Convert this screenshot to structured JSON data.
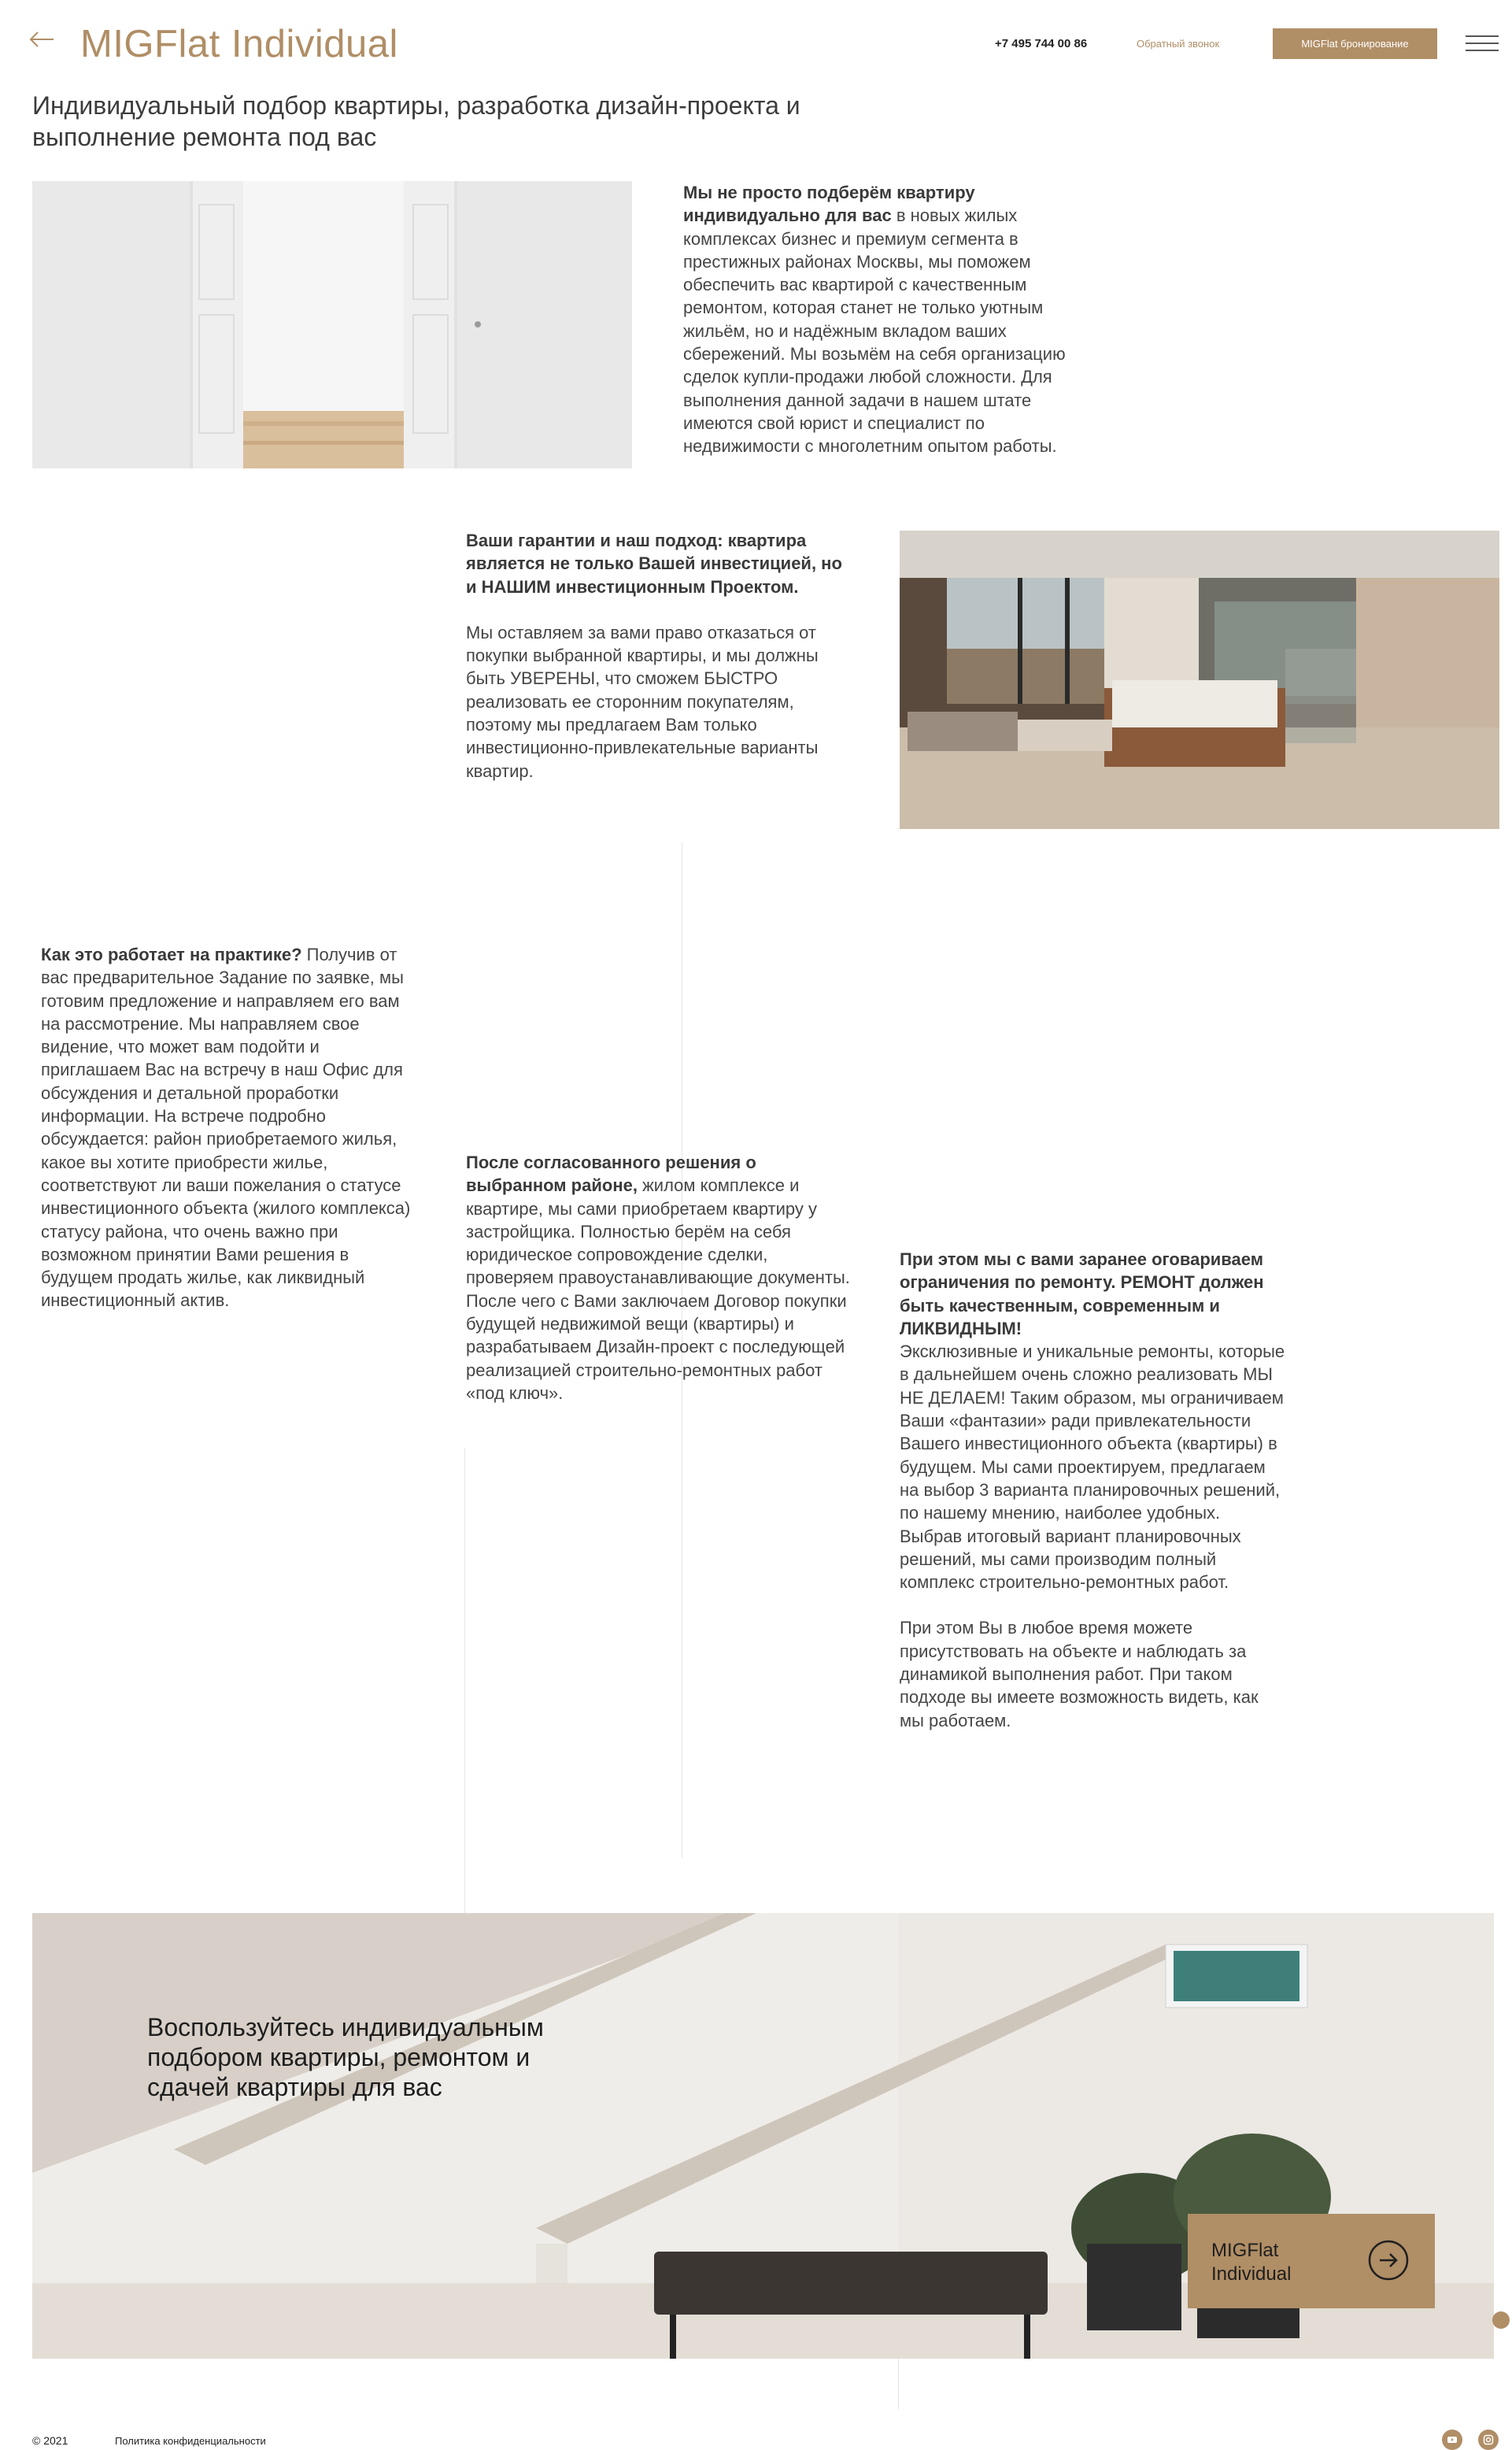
{
  "header": {
    "title": "MIGFlat Individual",
    "phone": "+7 495 744 00 86",
    "callback_label": "Обратный звонок",
    "booking_label": "MIGFlat бронирование"
  },
  "subtitle": "Индивидуальный подбор квартиры, разработка дизайн-проекта и выполнение ремонта под вас",
  "blocks": {
    "b1_bold": "Мы не просто подберём квартиру индивидуально для вас",
    "b1_text": " в новых жилых комплексах бизнес и премиум сегмента в престижных районах Москвы, мы поможем обеспечить вас квартирой с качественным ремонтом, которая станет не только уютным жильём, но и надёжным вкладом ваших сбережений. Мы возьмём на себя организацию сделок купли-продажи любой сложности. Для выполнения данной задачи в нашем штате имеются свой юрист и специалист по недвижимости с многолетним опытом работы.",
    "b2_bold": "Ваши гарантии и наш подход: квартира является не только Вашей инвестицией, но и НАШИМ инвестиционным Проектом.",
    "b2_text": "Мы оставляем за вами право отказаться от покупки выбранной квартиры, и мы должны быть УВЕРЕНЫ, что сможем БЫСТРО реализовать ее сторонним покупателям, поэтому мы предлагаем Вам только инвестиционно-привлекательные варианты квартир.",
    "b3_bold": "Как это работает на практике?",
    "b3_text": " Получив от вас предварительное Задание по заявке, мы готовим предложение и направляем его вам на рассмотрение. Мы направляем свое видение, что может вам подойти и приглашаем Вас на встречу в наш Офис для обсуждения и детальной проработки информации. На встрече подробно обсуждается: район приобретаемого жилья, какое вы хотите приобрести жилье, соответствуют ли ваши пожелания о статусе инвестиционного объекта (жилого комплекса) статусу района, что очень важно при возможном принятии Вами решения в будущем продать жилье, как ликвидный инвестиционный актив.",
    "b4_bold": "После согласованного решения о выбранном районе,",
    "b4_text": " жилом комплексе и квартире, мы сами приобретаем квартиру у застройщика. Полностью берём на себя юридическое сопровождение сделки, проверяем правоустанавливающие документы. После чего с Вами заключаем Договор покупки будущей недвижимой вещи (квартиры) и разрабатываем Дизайн-проект с последующей реализацией строительно-ремонтных работ «под ключ».",
    "b5_bold": "При этом мы с вами заранее оговариваем ограничения по ремонту. РЕМОНТ должен быть качественным, современным и ЛИКВИДНЫМ!",
    "b5_text": "Эксклюзивные и уникальные ремонты, которые в дальнейшем очень сложно реализовать МЫ НЕ ДЕЛАЕМ! Таким образом, мы ограничиваем Ваши «фантазии» ради привлекательности Вашего инвестиционного объекта (квартиры) в будущем. Мы сами проектируем, предлагаем на выбор 3 варианта планировочных решений, по нашему мнению, наиболее удобных. Выбрав итоговый вариант планировочных решений, мы сами производим полный комплекс строительно-ремонтных работ.",
    "b5_text2": "При этом Вы в любое время можете присутствовать на объекте и наблюдать за динамикой выполнения работ. При таком подходе вы имеете возможность видеть, как мы работаем."
  },
  "banner": {
    "heading": "Воспользуйтесь индивидуальным подбором квартиры, ремонтом и сдачей квартиры для вас",
    "card_label": "MIGFlat Individual"
  },
  "footer": {
    "copyright": "© 2021",
    "policy": "Политика конфиденциальности"
  },
  "icons": {
    "back": "arrow-left-icon",
    "menu": "hamburger-menu-icon",
    "card": "arrow-right-circle-icon",
    "youtube": "youtube-icon",
    "instagram": "instagram-icon"
  },
  "colors": {
    "accent": "#b08e66",
    "text": "#3c3c3c"
  }
}
